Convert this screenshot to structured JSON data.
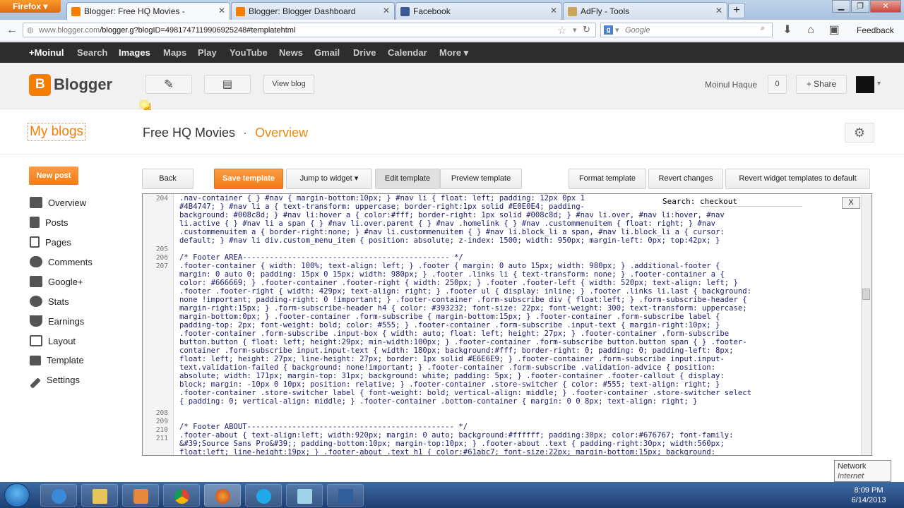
{
  "browser": {
    "app_button": "Firefox",
    "tabs": [
      {
        "title": "Blogger: Free HQ Movies -",
        "active": true
      },
      {
        "title": "Blogger: Blogger Dashboard",
        "active": false
      },
      {
        "title": "Facebook",
        "active": false
      },
      {
        "title": "AdFly - Tools",
        "active": false
      }
    ],
    "new_tab": "+",
    "url_host": "www.blogger.com",
    "url_rest": "/blogger.g?blogID=4981747119906925248#templatehtml",
    "search_placeholder": "Google",
    "feedback": "Feedback"
  },
  "google_bar": {
    "items": [
      "+Moinul",
      "Search",
      "Images",
      "Maps",
      "Play",
      "YouTube",
      "News",
      "Gmail",
      "Drive",
      "Calendar",
      "More ▾"
    ]
  },
  "blogger_header": {
    "brand": "Blogger",
    "view_blog": "View blog",
    "user_name": "Moinul Haque",
    "notifications": "0",
    "share": "+ Share"
  },
  "subheader": {
    "my_blogs": "My blogs",
    "blog_name": "Free HQ Movies",
    "separator": "·",
    "section": "Overview"
  },
  "sidebar": {
    "new_post": "New post",
    "items": [
      "Overview",
      "Posts",
      "Pages",
      "Comments",
      "Google+",
      "Stats",
      "Earnings",
      "Layout",
      "Template",
      "Settings"
    ]
  },
  "toolbar": {
    "back": "Back",
    "save": "Save template",
    "jump": "Jump to widget ▾",
    "edit": "Edit template",
    "preview": "Preview template",
    "format": "Format template",
    "revert": "Revert changes",
    "revert_widgets": "Revert widget templates to default"
  },
  "editor": {
    "search_label": "Search:",
    "search_value": "checkout",
    "close": "X",
    "line_numbers": [
      "204",
      "205",
      "206",
      "207",
      "208",
      "209",
      "210",
      "211"
    ],
    "lines": [
      ".nav-container { } #nav { margin-bottom:10px; } #nav li { float: left; padding: 12px 0px 1",
      "#4B4747; } #nav li a { text-transform: uppercase; border-right:1px solid #E0E0E4; padding-",
      "background: #008c8d; } #nav li:hover a { color:#fff; border-right: 1px solid #008c8d; } #nav li.over, #nav li:hover, #nav",
      "li.active { } #nav li a span { } #nav li.over.parent { } #nav .homelink { } #nav .custommenuitem { float: right; } #nav",
      ".custommenuitem a { border-right:none; } #nav li.custommenuitem { } #nav li.block_li a span, #nav li.block_li a { cursor:",
      "default; } #nav li div.custom_menu_item { position: absolute; z-index: 1500; width: 950px; margin-left: 0px; top:42px; }",
      "",
      "/* Footer AREA---------------------------------------------- */",
      ".footer-container { width: 100%; text-align: left; } .footer { margin: 0 auto 15px; width: 980px; } .additional-footer {",
      "margin: 0 auto 0; padding: 15px 0 15px; width: 980px; } .footer .links li { text-transform: none; } .footer-container a {",
      "color: #666669; } .footer-container .footer-right { width: 250px; } .footer .footer-left { width: 520px; text-align: left; }",
      ".footer .footer-right { width: 429px; text-align: right; } .footer ul { display: inline; } .footer .links li.last { background:",
      "none !important; padding-right: 0 !important; } .footer-container .form-subscribe div { float:left; } .form-subscribe-header {",
      "margin-right:15px; } .form-subscribe-header h4 { color: #393232; font-size: 22px; font-weight: 300; text-transform: uppercase;",
      "margin-bottom:0px; } .footer-container .form-subscribe { margin-bottom:15px; } .footer-container .form-subscribe label {",
      "padding-top: 2px; font-weight: bold; color: #555; } .footer-container .form-subscribe .input-text { margin-right:10px; }",
      ".footer-container .form-subscribe .input-box { width: auto; float: left; height: 27px; } .footer-container .form-subscribe",
      "button.button { float: left; height:29px; min-width:100px; } .footer-container .form-subscribe button.button span { } .footer-",
      "container .form-subscribe input.input-text { width: 180px; background:#fff; border-right: 0; padding: 0; padding-left: 8px;",
      "float: left; height: 27px; line-height: 27px; border: 1px solid #E6E6E9; } .footer-container .form-subscribe input.input-",
      "text.validation-failed { background: none!important; } .footer-container .form-subscribe .validation-advice { position:",
      "absolute; width: 171px; margin-top: 31px; background: white; padding: 5px; } .footer-container .footer-callout { display:",
      "block; margin: -10px 0 10px; position: relative; } .footer-container .store-switcher { color: #555; text-align: right; }",
      ".footer-container .store-switcher label { font-weight: bold; vertical-align: middle; } .footer-container .store-switcher select",
      "{ padding: 0; vertical-align: middle; } .footer-container .bottom-container { margin: 0 0 8px; text-align: right; }",
      "",
      "",
      "/* Footer ABOUT---------------------------------------------- */",
      ".footer-about { text-align:left; width:920px; margin: 0 auto; background:#ffffff; padding:30px; color:#676767; font-family:",
      "&#39;Source Sans Pro&#39;; padding-bottom:10px; margin-top:10px; } .footer-about .text { padding-right:30px; width:560px;",
      "float:left; line-height:19px; } .footer-about .text h1 { color:#61abc7; font-size:22px; margin-bottom:15px; background:"
    ]
  },
  "taskbar": {
    "tooltip_title": "Network",
    "tooltip_sub": "Internet access",
    "time": "8:09 PM",
    "date": "6/14/2013"
  }
}
